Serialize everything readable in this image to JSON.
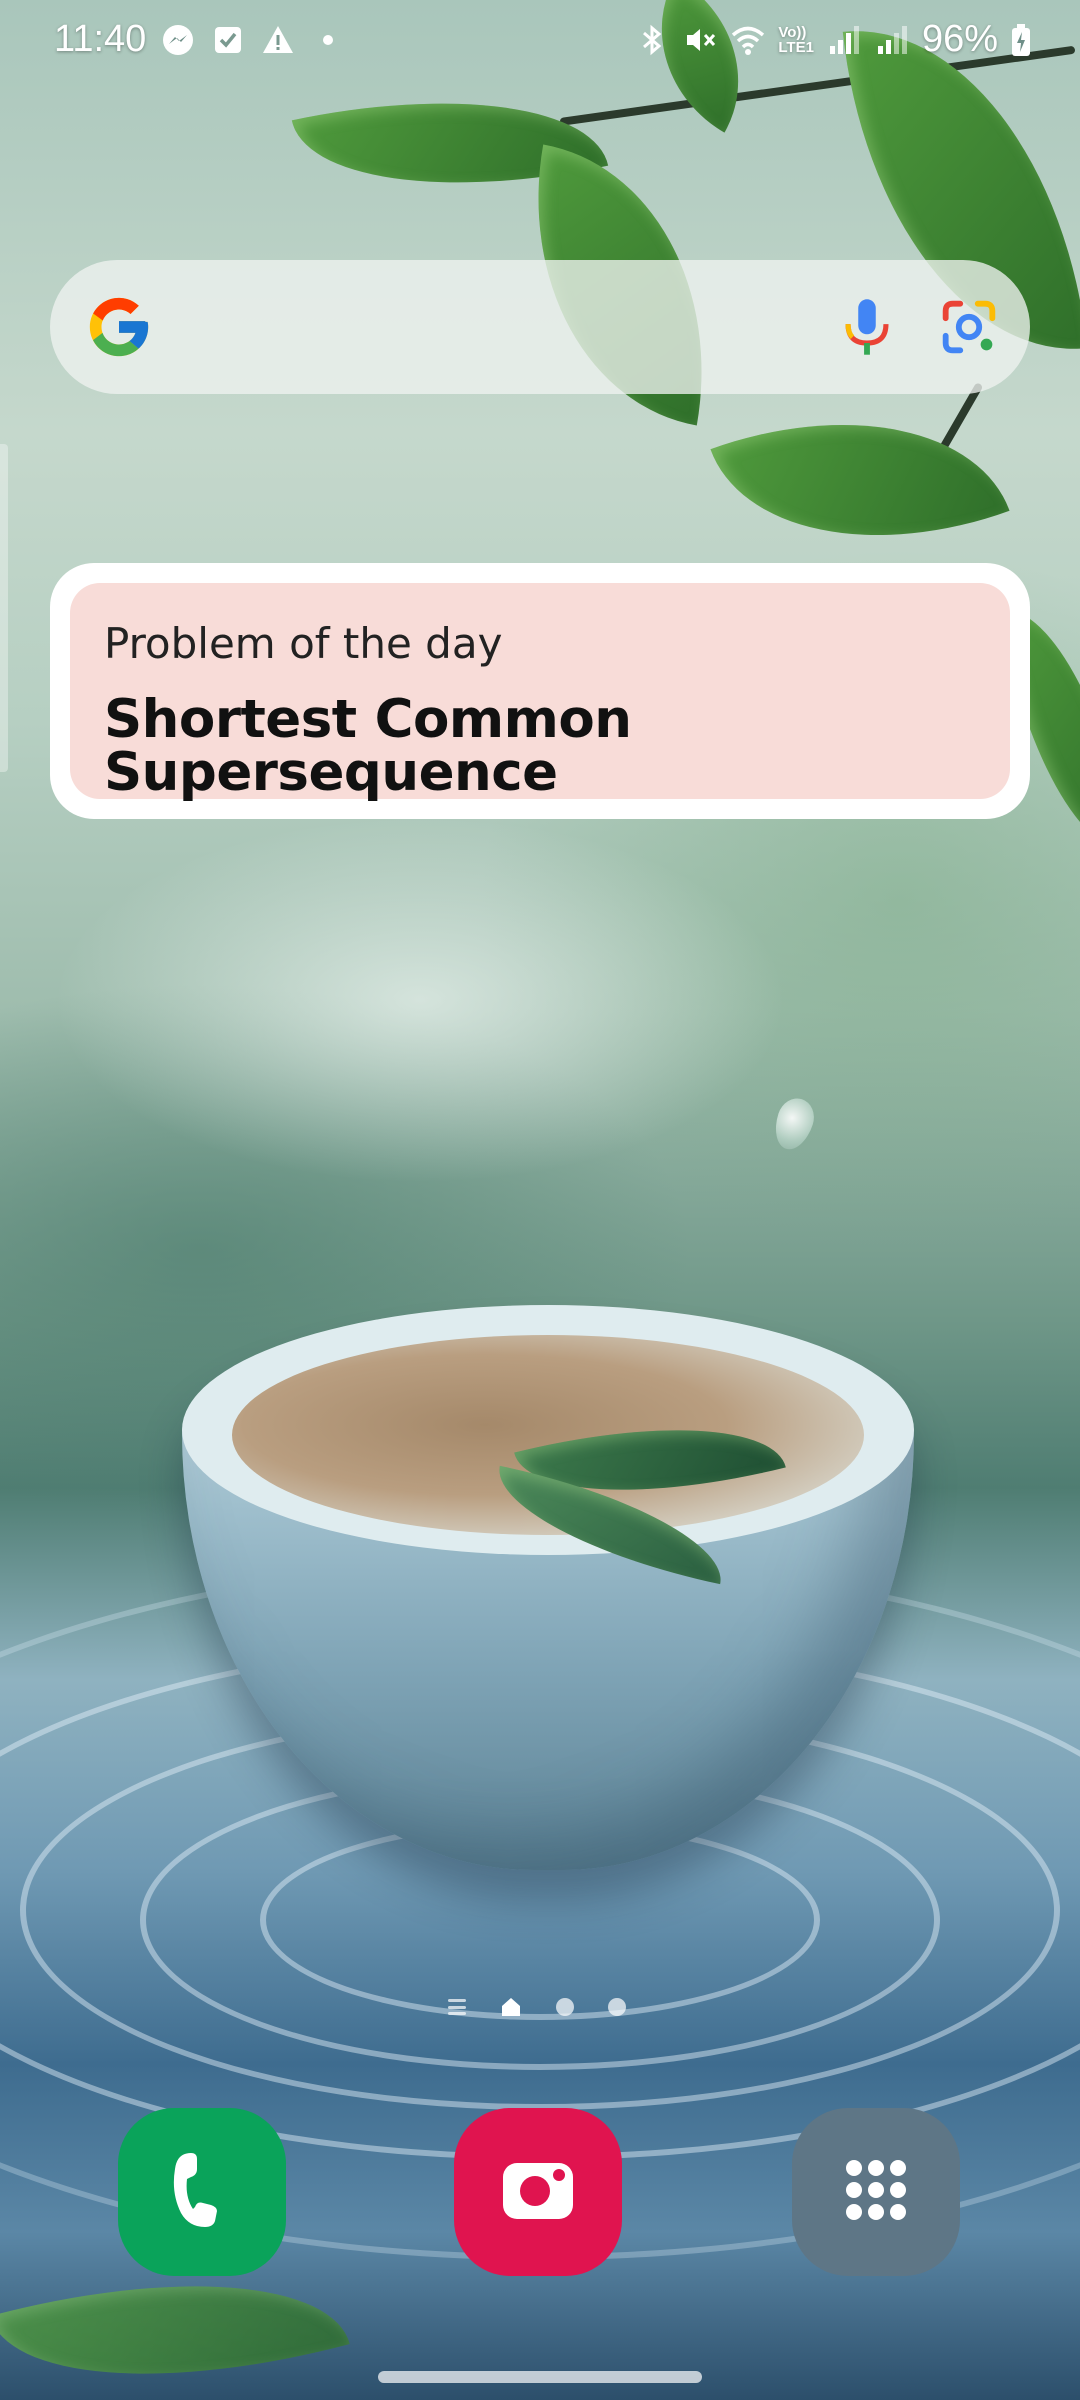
{
  "status_bar": {
    "time": "11:40",
    "battery_percent": "96%",
    "left_icons": [
      "messenger-icon",
      "checkbox-notification-icon",
      "warning-icon",
      "dot-icon"
    ],
    "right_icons": [
      "bluetooth-icon",
      "mute-icon",
      "wifi-icon",
      "volte-lte-icon",
      "signal-icon",
      "signal-icon-2",
      "battery-charging-icon"
    ],
    "volte_label_top": "Vo))",
    "volte_label_bottom": "LTE1"
  },
  "search_bar": {
    "icons": [
      "google-logo-icon",
      "microphone-icon",
      "google-lens-icon"
    ]
  },
  "widget": {
    "label": "Problem of the day",
    "title": "Shortest Common Supersequence",
    "background_color": "#f8dcd8"
  },
  "page_indicator": {
    "pages": [
      "menu-lines-icon",
      "home-icon",
      "dot",
      "dot"
    ],
    "active": "home-icon"
  },
  "dock": {
    "apps": [
      {
        "name": "phone",
        "icon": "phone-icon",
        "color": "#0aa35a"
      },
      {
        "name": "camera",
        "icon": "camera-icon",
        "color": "#e0144f"
      },
      {
        "name": "app-drawer",
        "icon": "apps-grid-icon",
        "color": "#5e7686"
      }
    ]
  }
}
